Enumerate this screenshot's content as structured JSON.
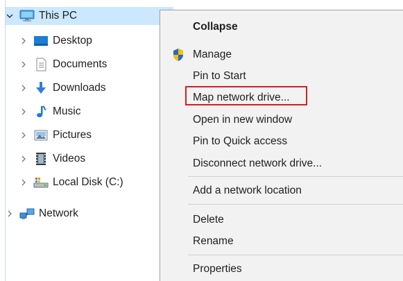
{
  "nav": {
    "this_pc": "This PC",
    "items": [
      {
        "label": "Desktop",
        "icon": "desktop-icon"
      },
      {
        "label": "Documents",
        "icon": "documents-icon"
      },
      {
        "label": "Downloads",
        "icon": "downloads-icon"
      },
      {
        "label": "Music",
        "icon": "music-icon"
      },
      {
        "label": "Pictures",
        "icon": "pictures-icon"
      },
      {
        "label": "Videos",
        "icon": "videos-icon"
      },
      {
        "label": "Local Disk (C:)",
        "icon": "local-disk-icon"
      }
    ],
    "network": "Network"
  },
  "menu": {
    "collapse": "Collapse",
    "manage": "Manage",
    "pin_to_start": "Pin to Start",
    "map_network_drive": "Map network drive...",
    "open_new_window": "Open in new window",
    "pin_quick_access": "Pin to Quick access",
    "disconnect_network_drive": "Disconnect network drive...",
    "add_network_location": "Add a network location",
    "delete": "Delete",
    "rename": "Rename",
    "properties": "Properties"
  },
  "colors": {
    "selection": "#cce8ff",
    "highlight_border": "#d51f1f",
    "menu_background": "#f2f2f2"
  }
}
